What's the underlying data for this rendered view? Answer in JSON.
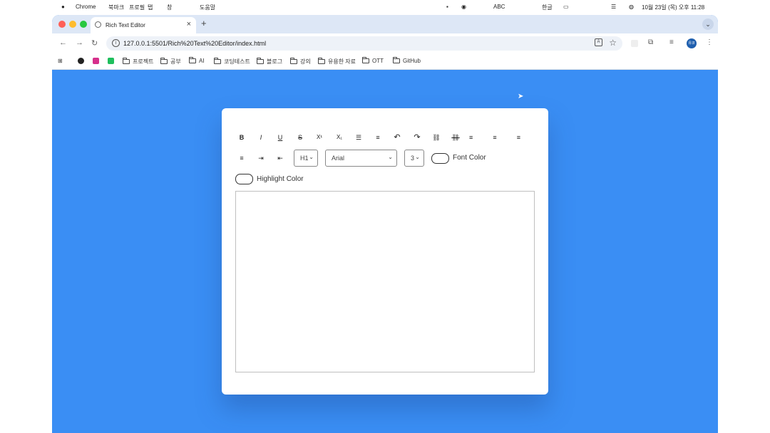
{
  "menubar": {
    "items": [
      "북마크",
      "프로필",
      "탭",
      "창",
      "도움말"
    ],
    "app": "Chrome",
    "status_left": [
      "ABC",
      "한글"
    ],
    "datetime": "10월 23일 (목) 오후 11:28"
  },
  "browser": {
    "tab_title": "Rich Text Editor",
    "new_tab": "+",
    "close_tab": "×",
    "url": "127.0.0.1:5501/Rich%20Text%20Editor/index.html",
    "avatar_text": "유코"
  },
  "bookmarks": [
    {
      "label": "프로젝트",
      "icon": "folder-icon"
    },
    {
      "label": "공부",
      "icon": "folder-icon"
    },
    {
      "label": "AI",
      "icon": "folder-icon"
    },
    {
      "label": "코딩테스트",
      "icon": "folder-icon"
    },
    {
      "label": "블로그",
      "icon": "folder-icon"
    },
    {
      "label": "강의",
      "icon": "folder-icon"
    },
    {
      "label": "유용한 자료",
      "icon": "folder-icon"
    },
    {
      "label": "OTT",
      "icon": "folder-icon"
    },
    {
      "label": "GitHub",
      "icon": "folder-icon"
    }
  ],
  "editor": {
    "buttons_row1": [
      {
        "name": "bold",
        "glyph": "B"
      },
      {
        "name": "italic",
        "glyph": "I"
      },
      {
        "name": "underline",
        "glyph": "U"
      },
      {
        "name": "strikethrough",
        "glyph": "S"
      },
      {
        "name": "superscript",
        "glyph": "X¹"
      },
      {
        "name": "subscript",
        "glyph": "X₁"
      },
      {
        "name": "ordered-list",
        "glyph": "☰"
      },
      {
        "name": "unordered-list",
        "glyph": "≡"
      },
      {
        "name": "undo",
        "glyph": "↶"
      },
      {
        "name": "redo",
        "glyph": "↷"
      },
      {
        "name": "link",
        "glyph": "⛓"
      },
      {
        "name": "unlink",
        "glyph": "⛓"
      },
      {
        "name": "align-left",
        "glyph": "≡"
      },
      {
        "name": "align-center",
        "glyph": "≡"
      },
      {
        "name": "align-right",
        "glyph": "≡"
      }
    ],
    "buttons_row2": [
      {
        "name": "align-justify",
        "glyph": "≡"
      },
      {
        "name": "indent",
        "glyph": "⇥"
      },
      {
        "name": "outdent",
        "glyph": "⇤"
      }
    ],
    "heading_select": "H1",
    "font_select": "Arial",
    "size_select": "3",
    "font_color_label": "Font Color",
    "highlight_color_label": "Highlight Color"
  },
  "colors": {
    "page_bg": "#3a8ef4",
    "card_bg": "#ffffff",
    "tabstrip_bg": "#dde7f6"
  }
}
